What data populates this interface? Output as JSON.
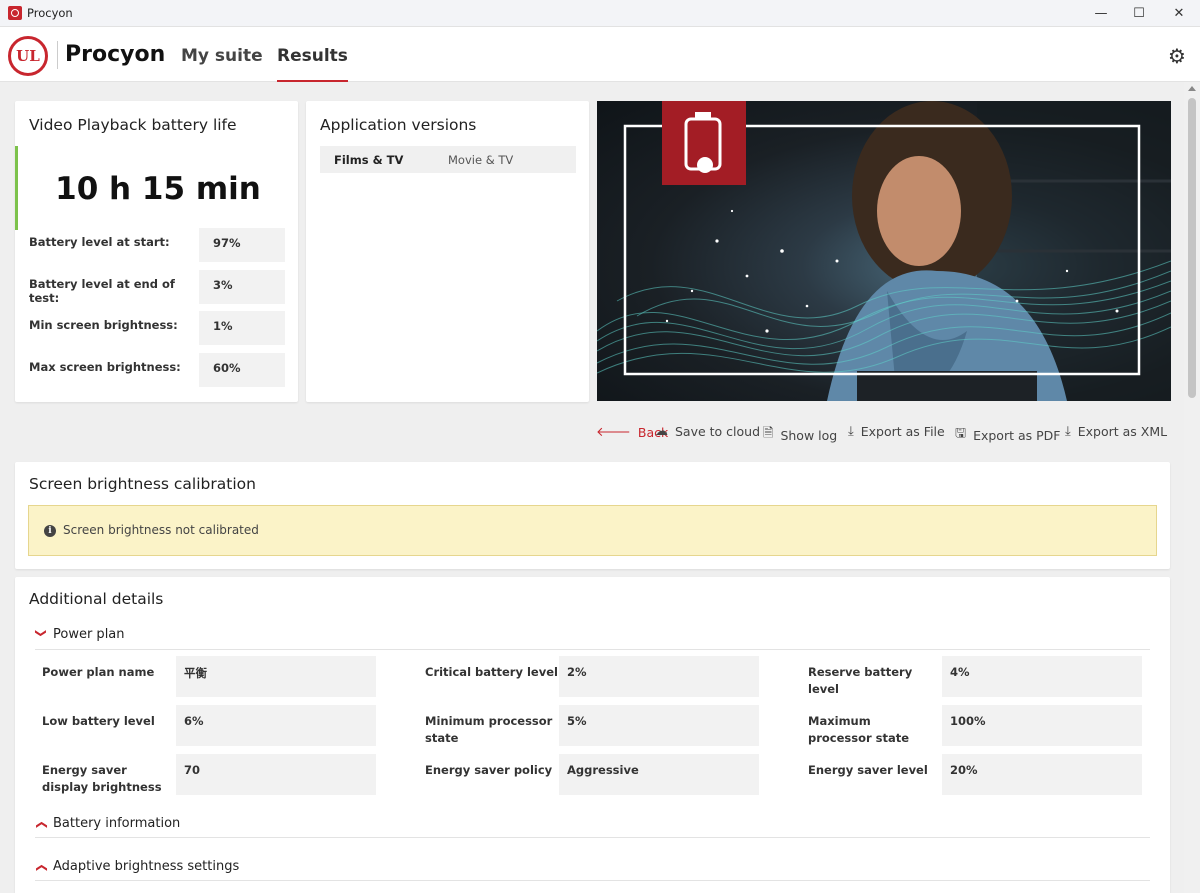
{
  "window": {
    "title": "Procyon",
    "minimize_glyph": "—",
    "maximize_glyph": "☐",
    "close_glyph": "✕"
  },
  "header": {
    "logo_text": "UL",
    "brand": "Procyon",
    "tabs": [
      {
        "label": "My suite",
        "active": false
      },
      {
        "label": "Results",
        "active": true
      }
    ],
    "settings_icon": "gear-icon"
  },
  "result_card": {
    "title": "Video Playback battery life",
    "score": "10 h 15 min",
    "accent_color": "#7dc24b",
    "rows": [
      {
        "label": "Battery level at start:",
        "value": "97%"
      },
      {
        "label": "Battery level at end of test:",
        "value": "3%"
      },
      {
        "label": "Min screen brightness:",
        "value": "1%"
      },
      {
        "label": "Max screen brightness:",
        "value": "60%"
      }
    ]
  },
  "app_versions": {
    "title": "Application versions",
    "app_name": "Films & TV",
    "app_version": "Movie & TV"
  },
  "actions": [
    {
      "label": "Back",
      "icon": "arrow-left-icon"
    },
    {
      "label": "Save to cloud",
      "icon": "cloud-upload-icon"
    },
    {
      "label": "Show log",
      "icon": "document-icon"
    },
    {
      "label": "Export as File",
      "icon": "download-icon"
    },
    {
      "label": "Export as PDF",
      "icon": "floppy-icon"
    },
    {
      "label": "Export as XML",
      "icon": "download-icon"
    }
  ],
  "calibration": {
    "title": "Screen brightness calibration",
    "warning": "Screen brightness not calibrated"
  },
  "details": {
    "title": "Additional details",
    "power_plan": {
      "heading": "Power plan",
      "items": [
        {
          "label": "Power plan name",
          "value": "平衡"
        },
        {
          "label": "Critical battery level",
          "value": "2%"
        },
        {
          "label": "Reserve battery level",
          "value": "4%"
        },
        {
          "label": "Low battery level",
          "value": "6%"
        },
        {
          "label": "Minimum processor state",
          "value": "5%"
        },
        {
          "label": "Maximum processor state",
          "value": "100%"
        },
        {
          "label": "Energy saver display brightness",
          "value": "70"
        },
        {
          "label": "Energy saver policy",
          "value": "Aggressive"
        },
        {
          "label": "Energy saver level",
          "value": "20%"
        }
      ]
    },
    "battery_info": {
      "heading": "Battery information"
    },
    "adaptive_brightness": {
      "heading": "Adaptive brightness settings"
    }
  },
  "colors": {
    "brand_red": "#c8262e",
    "warning_bg": "#fbf3c8"
  }
}
